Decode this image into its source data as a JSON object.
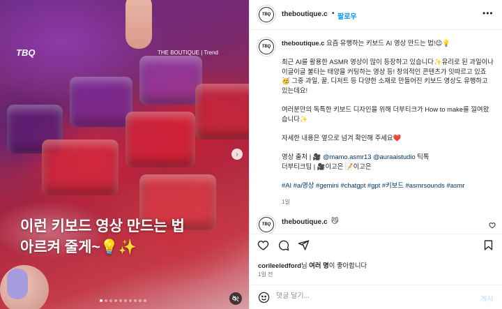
{
  "media": {
    "watermark": "TBQ",
    "brand_trend": "THE BOUTIQUE | Trend",
    "caption_line1": "이런 키보드 영상 만드는 법",
    "caption_line2": "아르켜 줄게~💡✨",
    "slide_count": 10,
    "active_slide": 0
  },
  "header": {
    "avatar_text": "TBQ",
    "username": "theboutique.c",
    "dot": "•",
    "follow": "팔로우"
  },
  "post": {
    "username": "theboutique.c",
    "title": " 요즘 유행하는 키보드 AI 영상 만드는 법!😉💡",
    "para1": "최근 AI를 활용한 ASMR 영상이 많이 등장하고 있습니다✨유리로 된 과일이나 이글이글 불타는 태양을 커팅하는 영상 등! 창의적인 콘텐츠가 잇따르고 있죠🥳 그중 과일, 꿀, 디저트 등 다양한 소재로 만들어진 키보드 영상도 유행하고 있는데요!",
    "para2": "여러분만의 독특한 키보드 디자인을 위해 더부티크가 How to make를 낄여왔습니다✨",
    "para3": "자세한 내용은 옆으로 넘겨 확인해 주세요❤️",
    "source_prefix": "영상 출처 | 🎥 ",
    "source_link1": "@mamo.asmr13",
    "source_link2": "@auraaistudio",
    "source_suffix": " 틱톡",
    "tips": "더부티크팁 | 🎥이고은 📝이고은",
    "hashtags": "#AI #ai영상 #gemini #chatgpt #gpt #키보드 #asmrsounds #asmr",
    "time": "1일"
  },
  "comment": {
    "username": "theboutique.c",
    "emoji": "😼"
  },
  "actions": {
    "likes_user": "corileeledford",
    "likes_text": "님 여러 명이 좋아합니다",
    "likes_bold": "여러 명",
    "date": "1일 전"
  },
  "comment_box": {
    "placeholder": "댓글 달기...",
    "post_label": "게시"
  },
  "colors": {
    "link": "#00376b",
    "follow": "#0095f6",
    "post_disabled": "#b2dffc"
  }
}
